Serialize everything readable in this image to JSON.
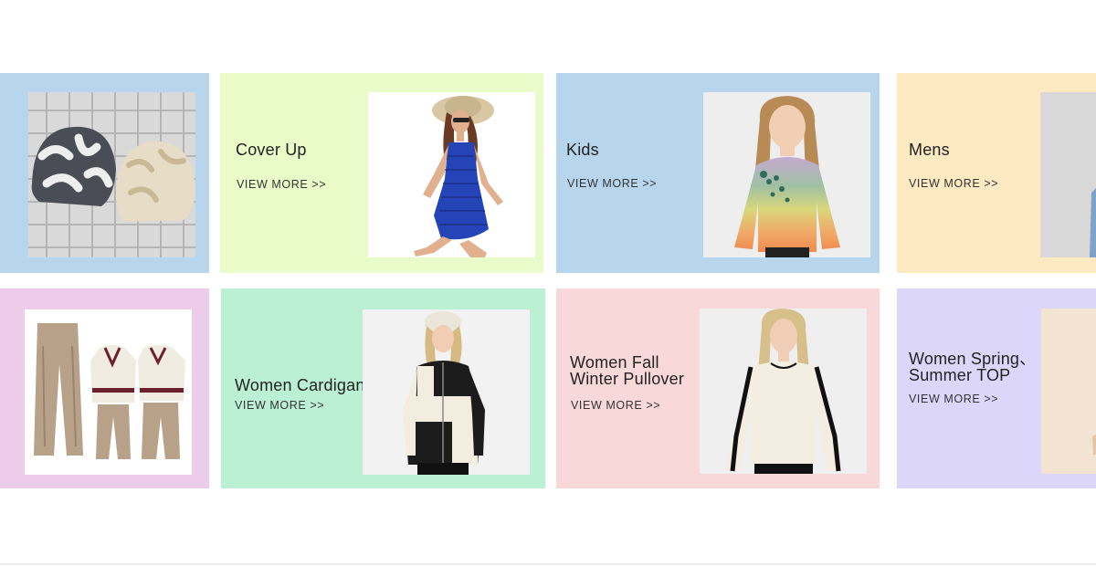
{
  "categories": [
    {
      "title": "",
      "view_more": "",
      "image": "knit-beanies-photo",
      "bg": "#b7d6ee"
    },
    {
      "title": "Cover Up",
      "view_more": "VIEW MORE >>",
      "image": "crochet-cover-up-dress-photo",
      "bg": "#e8fbc9"
    },
    {
      "title": "Kids",
      "view_more": "VIEW MORE >>",
      "image": "girl-rainbow-sweater-photo",
      "bg": "#b7d6ee"
    },
    {
      "title": "Mens",
      "view_more": "VIEW MORE >>",
      "image": "mens-shirt-photo",
      "bg": "#fde9c2"
    },
    {
      "title": "",
      "view_more": "",
      "image": "knit-pants-set-photo",
      "bg": "#eccce8"
    },
    {
      "title": "Women Cardigan",
      "view_more": "VIEW MORE >>",
      "image": "colorblock-cardigan-photo",
      "bg": "#bcf0d4"
    },
    {
      "title": "Women Fall\nWinter Pullover",
      "view_more": "VIEW MORE >>",
      "image": "cream-pullover-photo",
      "bg": "#f9d8da"
    },
    {
      "title": "Women Spring、\nSummer TOP",
      "view_more": "VIEW MORE >>",
      "image": "summer-top-photo",
      "bg": "#ddd6fb"
    }
  ]
}
